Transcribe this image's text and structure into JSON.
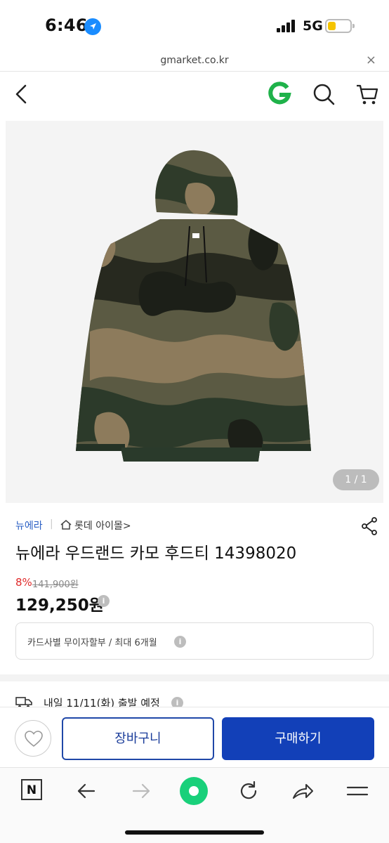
{
  "status_bar": {
    "time": "6:46",
    "network": "5G"
  },
  "url_bar": {
    "domain": "gmarket.co.kr",
    "close_label": "×"
  },
  "product": {
    "image_counter": "1 / 1",
    "brand": "뉴에라",
    "separator": "|",
    "store": "롯데 아이몰>",
    "title": "뉴에라 우드랜드 카모 후드티 14398020",
    "discount": "8%",
    "original_price": "141,900원",
    "price": "129,250원",
    "price_info_icon": "i"
  },
  "card_info": {
    "text": "카드사별 무이자할부 / 최대 6개월",
    "info_icon": "i"
  },
  "delivery": {
    "text": "내일 11/11(화) 출발 예정",
    "info_icon": "i"
  },
  "actions": {
    "cart_label": "장바구니",
    "buy_label": "구매하기"
  },
  "toolbar": {
    "n_label": "N"
  },
  "colors": {
    "brand_blue": "#1240b8",
    "discount_red": "#e02a2a",
    "g_green": "#1fb24a",
    "toolbar_green": "#19d07a"
  }
}
